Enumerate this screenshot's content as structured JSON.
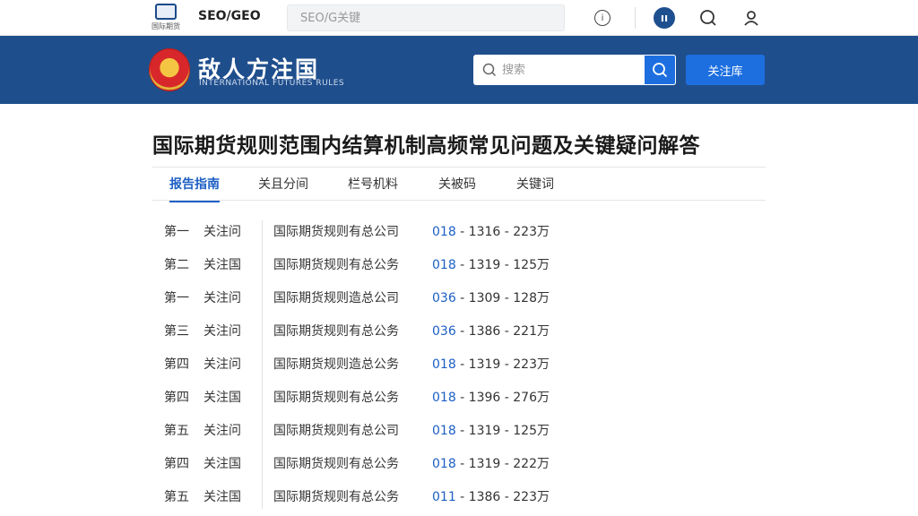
{
  "topbar": {
    "logo_caption": "国际期货",
    "brand": "SEO/GEO",
    "search_placeholder": "SEO/G关键"
  },
  "banner": {
    "title": "敌人方注国",
    "subtitle": "INTERNATIONAL FUTURES RULES",
    "search_placeholder": "搜索",
    "button_label": "关注库"
  },
  "page": {
    "title": "国际期货规则范围内结算机制高频常见问题及关键疑问解答"
  },
  "tabs": [
    {
      "label": "报告指南",
      "active": true
    },
    {
      "label": "关且分间",
      "active": false
    },
    {
      "label": "栏号机料",
      "active": false
    },
    {
      "label": "关被码",
      "active": false
    },
    {
      "label": "关键词",
      "active": false
    }
  ],
  "rows": [
    {
      "ord": "第一",
      "tag": "关注问",
      "org": "国际期货规则有总公司",
      "code_pre": "018",
      "code_rest": " - 1316 - 223万"
    },
    {
      "ord": "第二",
      "tag": "关注国",
      "org": "国际期货规则有总公务",
      "code_pre": "018",
      "code_rest": " - 1319 - 125万"
    },
    {
      "ord": "第一",
      "tag": "关注问",
      "org": "国际期货规则造总公司",
      "code_pre": "036",
      "code_rest": " - 1309 - 128万"
    },
    {
      "ord": "第三",
      "tag": "关注问",
      "org": "国际期货规则有总公务",
      "code_pre": "036",
      "code_rest": " - 1386 - 221万"
    },
    {
      "ord": "第四",
      "tag": "关注问",
      "org": "国际期货规则造总公务",
      "code_pre": "018",
      "code_rest": " - 1319 - 223万"
    },
    {
      "ord": "第四",
      "tag": "关注国",
      "org": "国际期货规则有总公务",
      "code_pre": "018",
      "code_rest": " - 1396 - 276万"
    },
    {
      "ord": "第五",
      "tag": "关注问",
      "org": "国际期货规则有总公司",
      "code_pre": "018",
      "code_rest": " - 1319 - 125万"
    },
    {
      "ord": "第四",
      "tag": "关注国",
      "org": "国际期货规则有总公务",
      "code_pre": "018",
      "code_rest": " - 1319 - 222万"
    },
    {
      "ord": "第五",
      "tag": "关注国",
      "org": "国际期货规则有总公务",
      "code_pre": "011",
      "code_rest": " - 1386 - 223万"
    }
  ],
  "icons": {
    "info": "circle-info-icon",
    "app": "app-badge-icon",
    "search": "search-icon",
    "user": "user-icon"
  },
  "colors": {
    "banner": "#1f4e8c",
    "accent": "#1d6fe0",
    "link": "#1d5fc4"
  }
}
